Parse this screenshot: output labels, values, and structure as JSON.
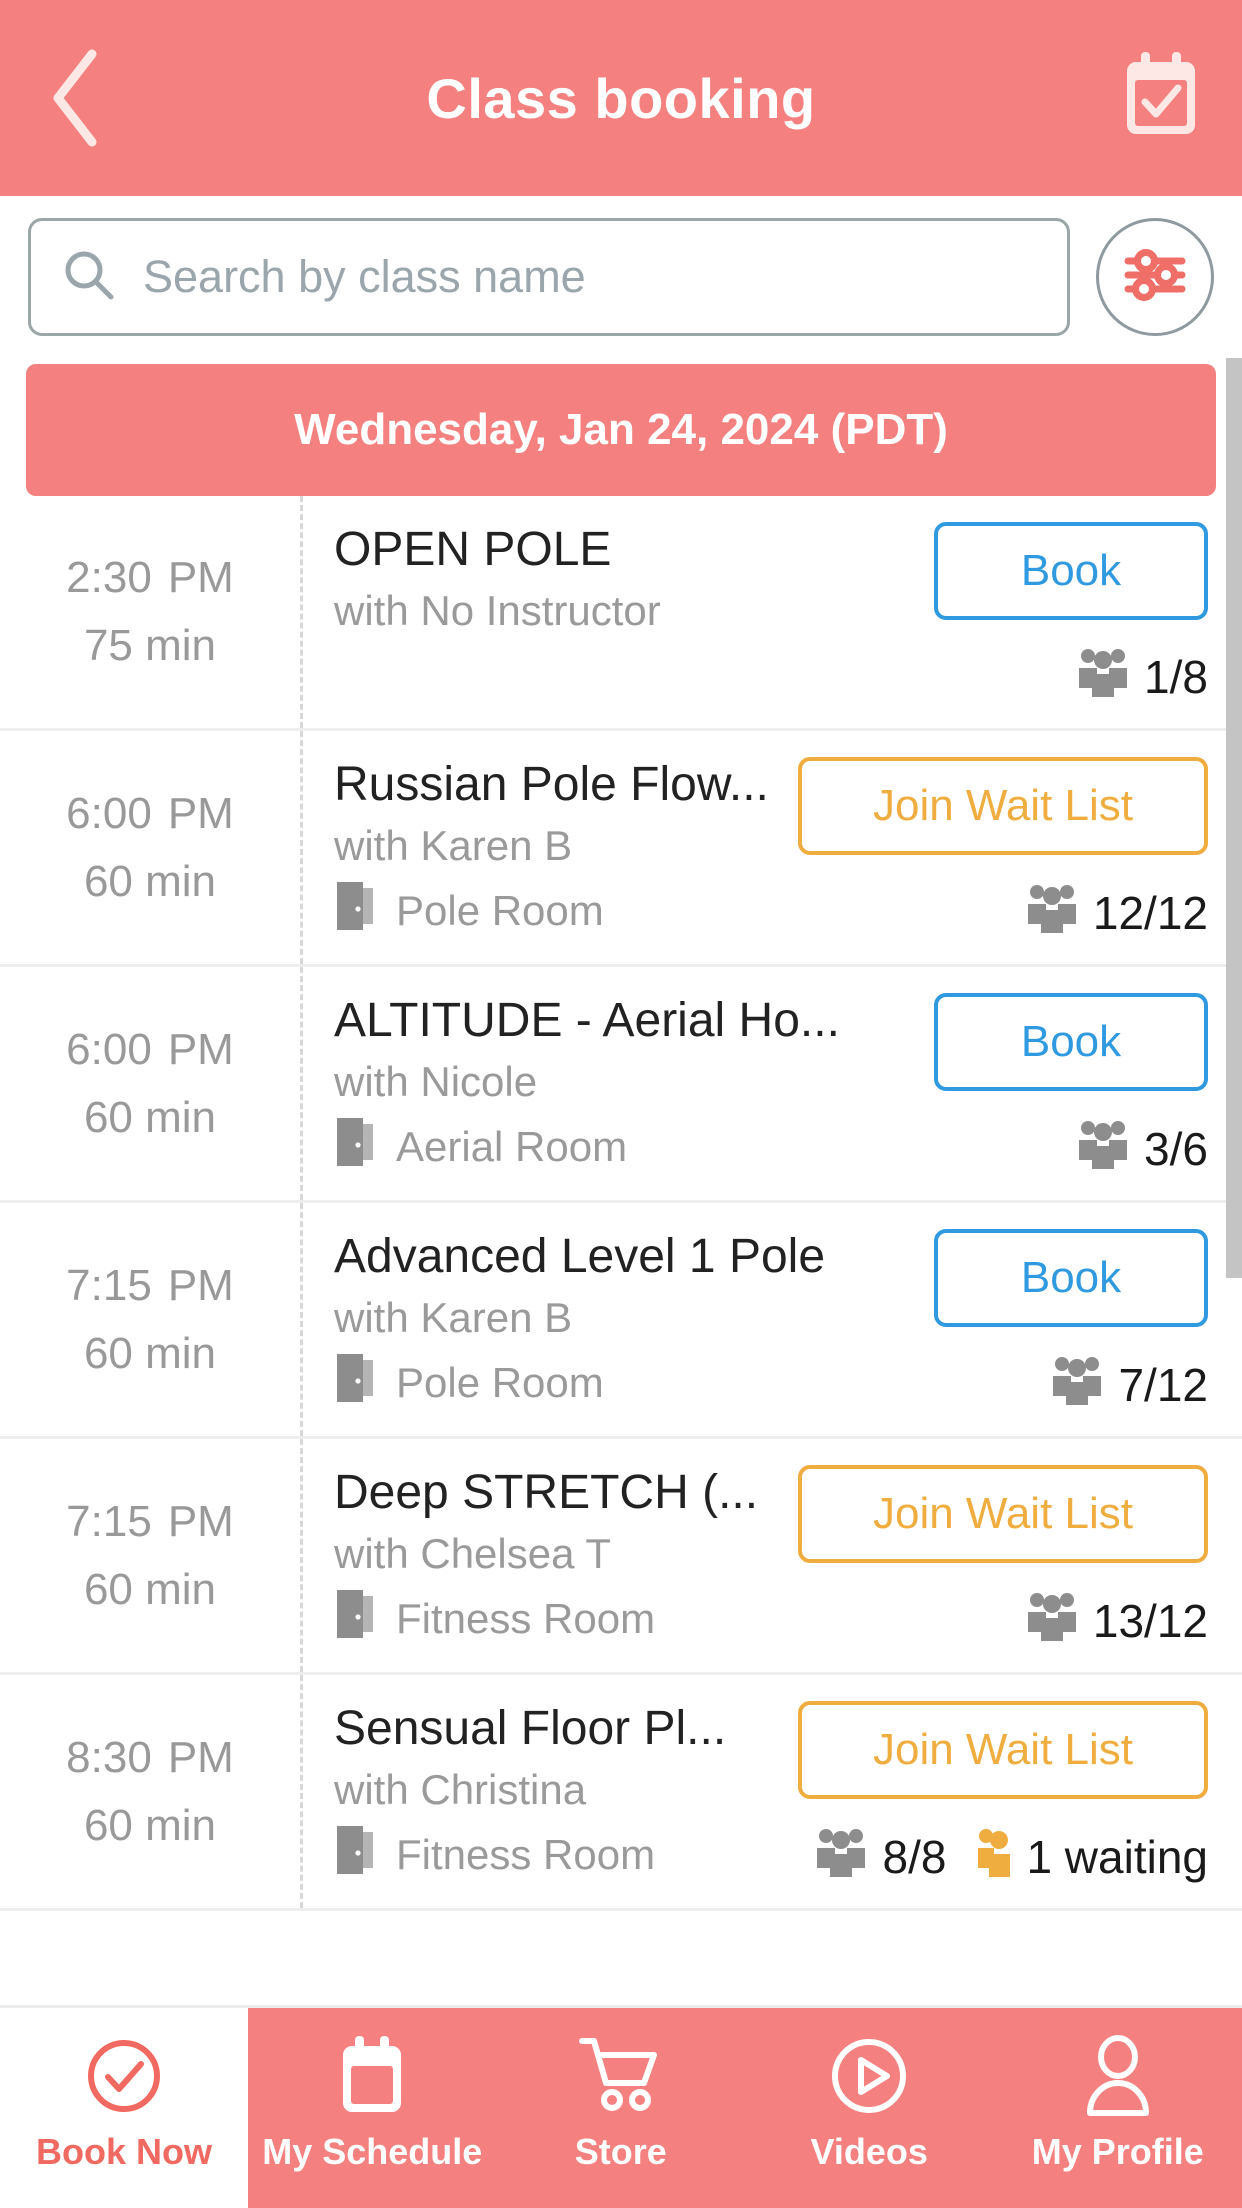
{
  "header": {
    "title": "Class booking",
    "back_icon": "chevron-left-icon",
    "action_icon": "calendar-check-icon"
  },
  "search": {
    "placeholder": "Search by class name",
    "value": "",
    "search_icon": "search-icon",
    "filter_icon": "filter-sliders-icon"
  },
  "date_banner": {
    "label": "Wednesday, Jan 24, 2024 (PDT)"
  },
  "classes": [
    {
      "time": "2:30",
      "meridiem": "PM",
      "duration": "75 min",
      "name": "OPEN POLE",
      "instructor": "with No Instructor",
      "room": "",
      "action_label": "Book",
      "action_type": "book",
      "capacity": "1/8",
      "waiting": ""
    },
    {
      "time": "6:00",
      "meridiem": "PM",
      "duration": "60 min",
      "name": "Russian Pole Flow...",
      "instructor": "with Karen B",
      "room": "Pole Room",
      "action_label": "Join Wait List",
      "action_type": "wait",
      "capacity": "12/12",
      "waiting": ""
    },
    {
      "time": "6:00",
      "meridiem": "PM",
      "duration": "60 min",
      "name": "ALTITUDE - Aerial Ho...",
      "instructor": "with Nicole",
      "room": "Aerial Room",
      "action_label": "Book",
      "action_type": "book",
      "capacity": "3/6",
      "waiting": ""
    },
    {
      "time": "7:15",
      "meridiem": "PM",
      "duration": "60 min",
      "name": "Advanced Level 1 Pole",
      "instructor": "with Karen B",
      "room": "Pole Room",
      "action_label": "Book",
      "action_type": "book",
      "capacity": "7/12",
      "waiting": ""
    },
    {
      "time": "7:15",
      "meridiem": "PM",
      "duration": "60 min",
      "name": "Deep STRETCH (...",
      "instructor": "with Chelsea T",
      "room": "Fitness Room",
      "action_label": "Join Wait List",
      "action_type": "wait",
      "capacity": "13/12",
      "waiting": ""
    },
    {
      "time": "8:30",
      "meridiem": "PM",
      "duration": "60 min",
      "name": "Sensual Floor Pl...",
      "instructor": "with Christina",
      "room": "Fitness Room",
      "action_label": "Join Wait List",
      "action_type": "wait",
      "capacity": "8/8",
      "waiting": "1 waiting"
    }
  ],
  "bottom_nav": [
    {
      "label": "Book Now",
      "icon": "check-circle-icon",
      "active": true
    },
    {
      "label": "My Schedule",
      "icon": "calendar-icon",
      "active": false
    },
    {
      "label": "Store",
      "icon": "cart-icon",
      "active": false
    },
    {
      "label": "Videos",
      "icon": "play-circle-icon",
      "active": false
    },
    {
      "label": "My Profile",
      "icon": "person-icon",
      "active": false
    }
  ],
  "colors": {
    "brand_coral": "#f58080",
    "book_blue": "#2f9ae0",
    "wait_orange": "#f0ad3f",
    "muted_gray": "#9a9a9a",
    "active_tab_text": "#f06a62"
  }
}
